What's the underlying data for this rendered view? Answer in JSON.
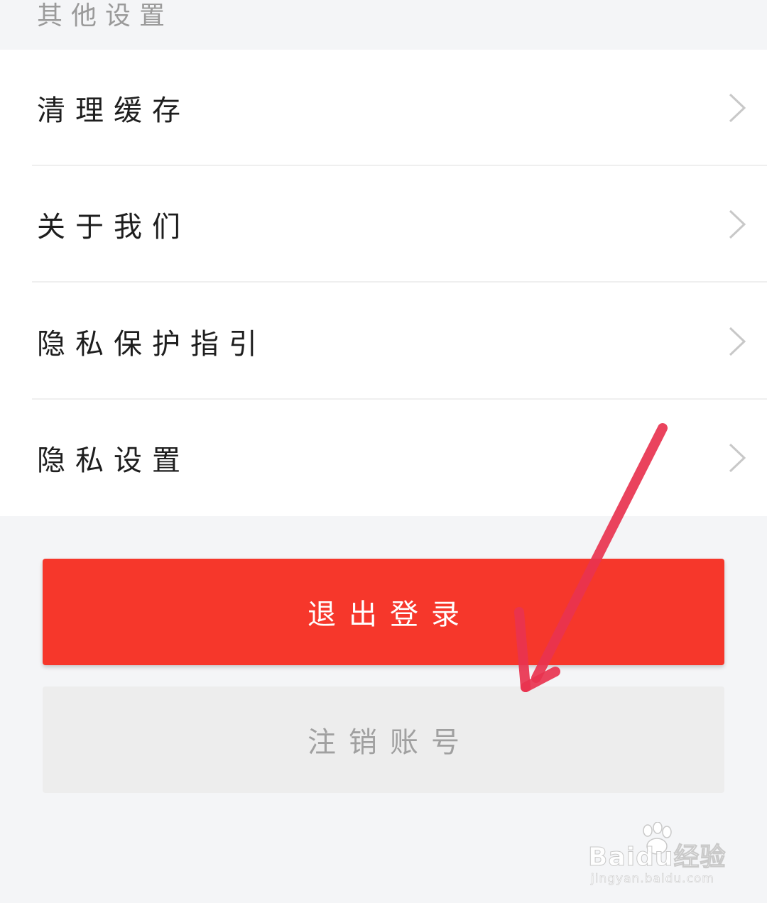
{
  "section": {
    "title": "其他设置"
  },
  "menu": {
    "items": [
      {
        "label": "清理缓存"
      },
      {
        "label": "关于我们"
      },
      {
        "label": "隐私保护指引"
      },
      {
        "label": "隐私设置"
      }
    ]
  },
  "buttons": {
    "logout_label": "退出登录",
    "cancel_account_label": "注销账号"
  },
  "colors": {
    "accent_red": "#f6372b",
    "annotation_arrow": "#e8334f"
  },
  "watermark": {
    "brand": "Baidu经验",
    "url": "jingyan.baidu.com"
  }
}
